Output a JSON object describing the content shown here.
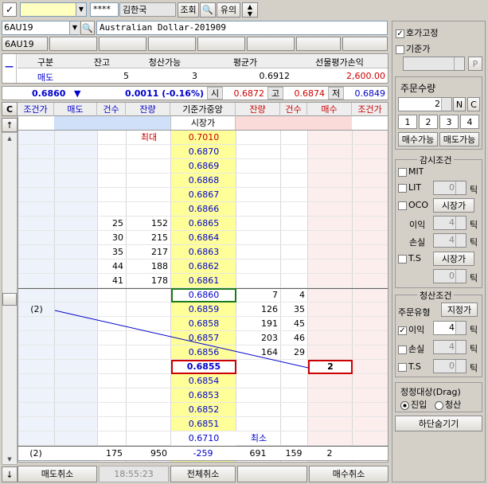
{
  "topbar": {
    "account_mask": "****",
    "user_name": "김한국",
    "query_btn": "조회",
    "key_icon": "key-icon",
    "fav_btn": "유의",
    "spin_icon": "updown-icon"
  },
  "symbol": {
    "code": "6AU19",
    "name": "Australian Dollar-201909",
    "tab": "6AU19"
  },
  "position_table": {
    "headers": [
      "구분",
      "잔고",
      "청산가능",
      "평균가",
      "선물평가손익"
    ],
    "row": {
      "side": "매도",
      "balance": "5",
      "closable": "3",
      "avg_price": "0.6912",
      "pnl": "2,600.00"
    }
  },
  "quote": {
    "price": "0.6860",
    "arrow": "▼",
    "change": "0.0011 (-0.16%)",
    "open_label": "시",
    "open": "0.6872",
    "high_label": "고",
    "high": "0.6874",
    "low_label": "저",
    "low": "0.6849"
  },
  "grid_headers": [
    "C",
    "조건가",
    "매도",
    "건수",
    "잔량",
    "기준가중앙",
    "잔량",
    "건수",
    "매수",
    "조건가"
  ],
  "start_label": "시장가",
  "max_label": "최대",
  "min_label": "최소",
  "up_arrow": "↑",
  "down_arrow": "↓",
  "rows": [
    {
      "price": "0.7010",
      "ask_cnt": "",
      "ask_qty": "",
      "bid_qty": "",
      "bid_cnt": "",
      "cond_left": "",
      "buy": ""
    },
    {
      "price": "0.6870",
      "ask_cnt": "",
      "ask_qty": "",
      "bid_qty": "",
      "bid_cnt": "",
      "cond_left": "",
      "buy": ""
    },
    {
      "price": "0.6869",
      "ask_cnt": "",
      "ask_qty": "",
      "bid_qty": "",
      "bid_cnt": "",
      "cond_left": "",
      "buy": ""
    },
    {
      "price": "0.6868",
      "ask_cnt": "",
      "ask_qty": "",
      "bid_qty": "",
      "bid_cnt": "",
      "cond_left": "",
      "buy": ""
    },
    {
      "price": "0.6867",
      "ask_cnt": "",
      "ask_qty": "",
      "bid_qty": "",
      "bid_cnt": "",
      "cond_left": "",
      "buy": ""
    },
    {
      "price": "0.6866",
      "ask_cnt": "",
      "ask_qty": "",
      "bid_qty": "",
      "bid_cnt": "",
      "cond_left": "",
      "buy": ""
    },
    {
      "price": "0.6865",
      "ask_cnt": "25",
      "ask_qty": "152",
      "bid_qty": "",
      "bid_cnt": "",
      "cond_left": "",
      "buy": ""
    },
    {
      "price": "0.6864",
      "ask_cnt": "30",
      "ask_qty": "215",
      "bid_qty": "",
      "bid_cnt": "",
      "cond_left": "",
      "buy": ""
    },
    {
      "price": "0.6863",
      "ask_cnt": "35",
      "ask_qty": "217",
      "bid_qty": "",
      "bid_cnt": "",
      "cond_left": "",
      "buy": ""
    },
    {
      "price": "0.6862",
      "ask_cnt": "44",
      "ask_qty": "188",
      "bid_qty": "",
      "bid_cnt": "",
      "cond_left": "",
      "buy": ""
    },
    {
      "price": "0.6861",
      "ask_cnt": "41",
      "ask_qty": "178",
      "bid_qty": "",
      "bid_cnt": "",
      "cond_left": "",
      "buy": ""
    },
    {
      "price": "0.6860",
      "ask_cnt": "",
      "ask_qty": "",
      "bid_qty": "7",
      "bid_cnt": "4",
      "cond_left": "",
      "buy": ""
    },
    {
      "price": "0.6859",
      "ask_cnt": "",
      "ask_qty": "",
      "bid_qty": "126",
      "bid_cnt": "35",
      "cond_left": "(2)",
      "buy": ""
    },
    {
      "price": "0.6858",
      "ask_cnt": "",
      "ask_qty": "",
      "bid_qty": "191",
      "bid_cnt": "45",
      "cond_left": "",
      "buy": ""
    },
    {
      "price": "0.6857",
      "ask_cnt": "",
      "ask_qty": "",
      "bid_qty": "203",
      "bid_cnt": "46",
      "cond_left": "",
      "buy": ""
    },
    {
      "price": "0.6856",
      "ask_cnt": "",
      "ask_qty": "",
      "bid_qty": "164",
      "bid_cnt": "29",
      "cond_left": "",
      "buy": ""
    },
    {
      "price": "0.6855",
      "ask_cnt": "",
      "ask_qty": "",
      "bid_qty": "",
      "bid_cnt": "",
      "cond_left": "",
      "buy": "2"
    },
    {
      "price": "0.6854",
      "ask_cnt": "",
      "ask_qty": "",
      "bid_qty": "",
      "bid_cnt": "",
      "cond_left": "",
      "buy": ""
    },
    {
      "price": "0.6853",
      "ask_cnt": "",
      "ask_qty": "",
      "bid_qty": "",
      "bid_cnt": "",
      "cond_left": "",
      "buy": ""
    },
    {
      "price": "0.6852",
      "ask_cnt": "",
      "ask_qty": "",
      "bid_qty": "",
      "bid_cnt": "",
      "cond_left": "",
      "buy": ""
    },
    {
      "price": "0.6851",
      "ask_cnt": "",
      "ask_qty": "",
      "bid_qty": "",
      "bid_cnt": "",
      "cond_left": "",
      "buy": ""
    },
    {
      "price": "0.6710",
      "ask_cnt": "",
      "ask_qty": "",
      "bid_qty": "",
      "bid_cnt": "",
      "cond_left": "",
      "buy": ""
    }
  ],
  "totals": {
    "cond_left": "(2)",
    "ask_cnt": "175",
    "ask_qty": "950",
    "diff": "-259",
    "bid_qty": "691",
    "bid_cnt": "159",
    "buy": "2"
  },
  "bottom": {
    "sell_cancel": "매도취소",
    "time": "18:55:23",
    "all_cancel": "전체취소",
    "buy_cancel": "매수취소"
  },
  "right": {
    "hoga_fixed": "호가고정",
    "base_price": "기준가",
    "p_btn": "P",
    "order_qty_title": "주문수량",
    "order_qty": "2",
    "n_btn": "N",
    "c_btn": "C",
    "qty_presets": [
      "1",
      "2",
      "3",
      "4"
    ],
    "buy_avail": "매수가능",
    "sell_avail": "매도가능",
    "watch_title": "감시조건",
    "mit": "MIT",
    "lit": "LIT",
    "lit_val": "0",
    "tick": "틱",
    "oco": "OCO",
    "market_btn": "시장가",
    "profit": "이익",
    "profit_val": "4",
    "loss": "손실",
    "loss_val": "4",
    "ts": "T.S",
    "ts_val": "0",
    "close_title": "청산조건",
    "order_type": "주문유형",
    "limit_btn": "지정가",
    "close_profit": "이익",
    "close_profit_val": "4",
    "close_loss": "손실",
    "close_loss_val": "4",
    "close_ts": "T.S",
    "close_ts_val": "0",
    "correct_title": "정정대상(Drag)",
    "entry": "진입",
    "liquidate": "청산",
    "hide_btn": "하단숨기기"
  }
}
